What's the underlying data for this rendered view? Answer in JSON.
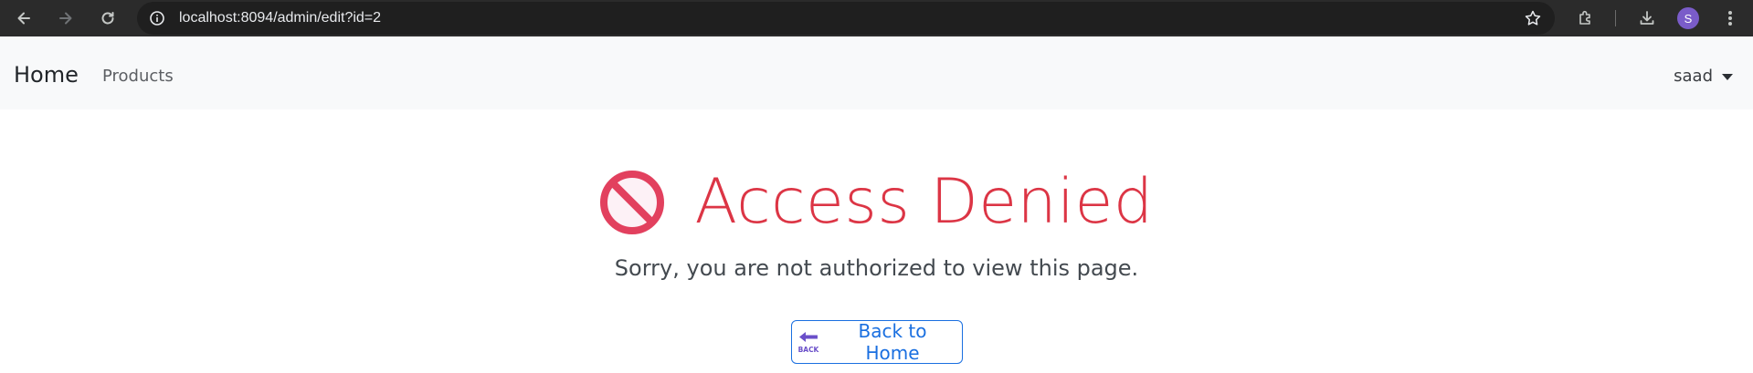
{
  "browser": {
    "url": "localhost:8094/admin/edit?id=2",
    "profile_initial": "S",
    "colors": {
      "toolbar": "#2b2b2b",
      "omnibox": "#1f1f1f",
      "avatar": "#7a5cc9"
    },
    "icons": [
      "back-arrow-icon",
      "forward-arrow-icon",
      "reload-icon",
      "site-info-icon",
      "bookmark-star-icon",
      "extensions-icon",
      "download-icon",
      "menu-kebab-icon"
    ]
  },
  "navbar": {
    "brand": "Home",
    "links": [
      {
        "label": "Products"
      }
    ],
    "user": {
      "name": "saad"
    }
  },
  "main": {
    "icon": "no-entry-icon",
    "heading": "Access Denied",
    "message": "Sorry, you are not authorized to view this page.",
    "back_button": {
      "label": "Back to Home",
      "icon": "back-arrow-emoji-icon"
    },
    "colors": {
      "heading": "#dc3545",
      "button": "#1a6fe0"
    }
  }
}
